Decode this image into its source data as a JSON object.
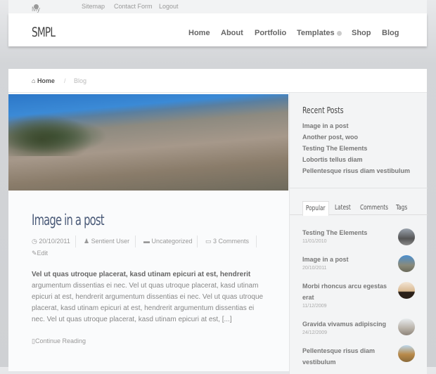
{
  "topbar": {
    "links": [
      "My Account",
      "Sitemap",
      "Contact Form",
      "Logout"
    ]
  },
  "header": {
    "logo": "SMPL",
    "nav": [
      "Home",
      "About",
      "Portfolio",
      "Templates",
      "Shop",
      "Blog"
    ]
  },
  "breadcrumb": {
    "home": "Home",
    "sep": "/",
    "current": "Blog"
  },
  "post": {
    "title": "Image in a post",
    "date": "20/10/2011",
    "author": "Sentient User",
    "category": "Uncategorized",
    "comments": "3 Comments",
    "edit": "Edit",
    "excerpt_bold": "Vel ut quas utroque placerat, kasd utinam epicuri at est, hendrerit",
    "excerpt": "argumentum dissentias ei nec. Vel ut quas utroque placerat, kasd utinam epicuri at est, hendrerit argumentum dissentias ei nec. Vel ut quas utroque placerat, kasd utinam epicuri at est, hendrerit argumentum dissentias ei nec. Vel ut quas utroque placerat, kasd utinam epicuri at est, [...]",
    "continue": "Continue Reading"
  },
  "sidebar": {
    "recent_title": "Recent Posts",
    "recent": [
      "Image in a post",
      "Another post, woo",
      "Testing The Elements",
      "Lobortis tellus diam",
      "Pellentesque risus diam vestibulum"
    ],
    "tabs": [
      "Popular",
      "Latest",
      "Comments",
      "Tags"
    ],
    "popular": [
      {
        "title": "Testing The Elements",
        "date": "11/01/2010"
      },
      {
        "title": "Image in a post",
        "date": "20/10/2011"
      },
      {
        "title": "Morbi rhoncus arcu egestas erat",
        "date": "11/12/2009"
      },
      {
        "title": "Gravida vivamus adipiscing",
        "date": "24/12/2009"
      },
      {
        "title": "Pellentesque risus diam vestibulum",
        "date": ""
      }
    ]
  }
}
